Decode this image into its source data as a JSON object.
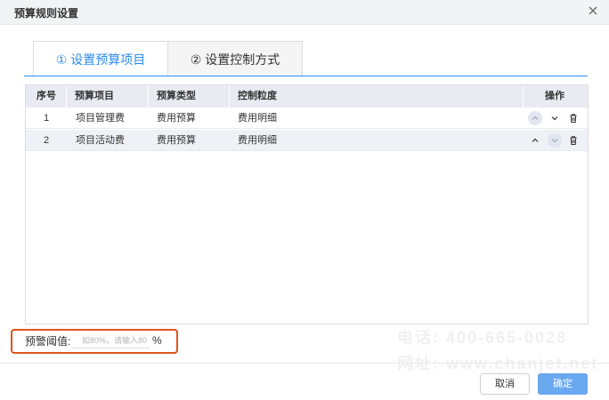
{
  "dialog": {
    "title": "预算规则设置"
  },
  "tabs": [
    {
      "label": "① 设置预算项目"
    },
    {
      "label": "② 设置控制方式"
    }
  ],
  "table": {
    "headers": [
      "序号",
      "预算项目",
      "预算类型",
      "控制粒度",
      "操作"
    ],
    "rows": [
      {
        "index": "1",
        "item": "项目管理费",
        "type": "费用预算",
        "granularity": "费用明细"
      },
      {
        "index": "2",
        "item": "项目活动费",
        "type": "费用预算",
        "granularity": "费用明细"
      }
    ]
  },
  "warning": {
    "label": "预警阈值:",
    "placeholder": "如80%，请输入80",
    "unit": "%"
  },
  "watermark": {
    "phone": "电话: 400-665-0028",
    "site": "网址: www.chanjet.net"
  },
  "footer": {
    "cancel": "取消",
    "ok": "确定"
  },
  "colors": {
    "accent": "#2d8cf0",
    "highlight": "#e0531f",
    "primary_button": "#6aa8ef"
  }
}
